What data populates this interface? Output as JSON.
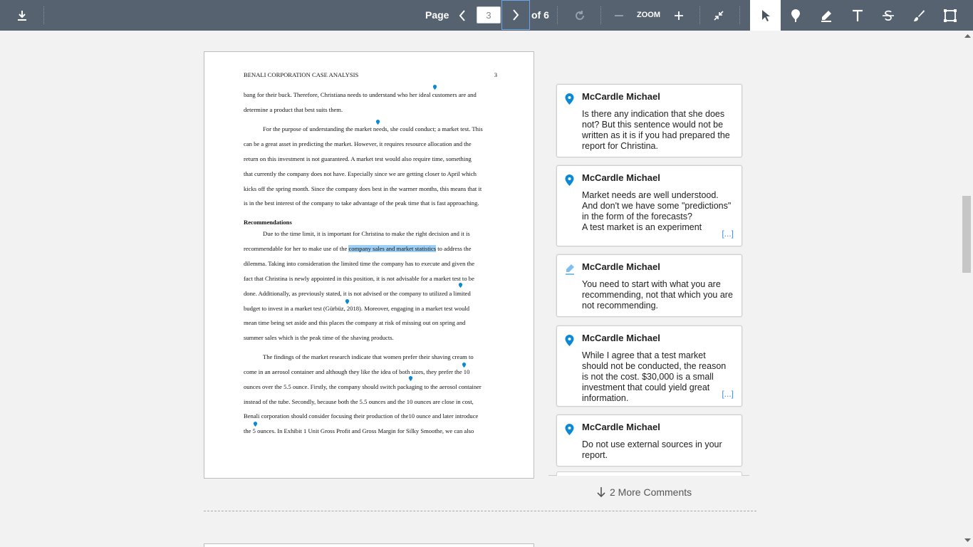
{
  "toolbar": {
    "page_label": "Page",
    "page_value": "3",
    "page_total": "of 6",
    "zoom_label": "ZOOM",
    "icons": [
      "download-icon",
      "chevron-left-icon",
      "chevron-right-icon",
      "rotate-icon",
      "zoom-out-icon",
      "zoom-in-icon",
      "collapse-icon",
      "pointer-icon",
      "pin-icon",
      "highlight-pen-icon",
      "text-icon",
      "strikethrough-icon",
      "brush-icon",
      "area-select-icon"
    ]
  },
  "document": {
    "header_title": "BENALI CORPORATION CASE ANALYSIS",
    "header_page": "3",
    "lines": [
      "bang for their buck. Therefore, Christiana needs to understand who her ideal customers are and",
      "determine a product that best suits them.",
      "For the purpose of understanding the market needs, she could conduct; a market test. This",
      "can be a great asset in predicting the market. However, it requires resource allocation and the",
      "return on this investment is not guaranteed.  A market test would also require time, something",
      "that currently the company does not have. Especially since we are getting closer to April which",
      "kicks off the spring month. Since the company does best in the warmer months, this means that it",
      "is in the best interest of the company to take advantage of the peak time that is fast approaching.",
      "Recommendations",
      "Due to the time limit, it is important for Christina to make the right decision and it is",
      "recommendable for her to make use of the ",
      "company sales and market statistics",
      " to address the",
      "dilemma. Taking into consideration the limited time the company has to execute and given the",
      "fact that Christina is newly appointed in this position, it is not advisable for a market test to be",
      "done. Additionally, as previously stated, it is not advised or the company to utilized a limited",
      "budget to invest in a market test (Gürbüz, 2018). Moreover, engaging in a market test would",
      "mean time being set aside and this places the company at risk of missing out on spring and",
      "summer sales which is the peak time of the shaving products.",
      "The findings of the market research indicate that women prefer their shaving cream to",
      "come in an aerosol container and although they like the idea of both sizes, they prefer the 10",
      "ounces over the 5.5 ounce. Firstly, the company should switch packaging to the aerosol container",
      "instead of the tube. Secondly, because both the 5.5 ounces and the 10 ounces are close in cost,",
      "Benali corporation should consider focusing their production of the10 ounce and later introduce",
      "the 5 ounces. In Exhibit 1 Unit Gross Profit and Gross Margin for Silky Smoothe, we can also"
    ]
  },
  "comments": [
    {
      "author": "McCardle Michael",
      "icon": "pin-icon",
      "text": "Is there any indication that she does not? But this sentence would not be written as it is if you had prepared the report for Christina.",
      "more": ""
    },
    {
      "author": "McCardle Michael",
      "icon": "pin-icon",
      "text": "Market needs are well understood. And don't we have some \"predictions\"  in the form of the forecasts?\nA test market is an experiment",
      "more": "[...]"
    },
    {
      "author": "McCardle Michael",
      "icon": "highlight-pen-icon",
      "text": "You need to start with what you are recommending, not that which you are not recommending.",
      "more": ""
    },
    {
      "author": "McCardle Michael",
      "icon": "pin-icon",
      "text": "While I agree that a test market should not be conducted, the reason is not the cost. $30,000 is a small investment that could yield great information.",
      "more": "[...]"
    },
    {
      "author": "McCardle Michael",
      "icon": "pin-icon",
      "text": "Do not use external sources in your report.",
      "more": ""
    }
  ],
  "more_comments_label": "2 More Comments",
  "colors": {
    "toolbar": "#566270",
    "accent": "#0a8ad6",
    "highlight": "#9ed0f5"
  }
}
